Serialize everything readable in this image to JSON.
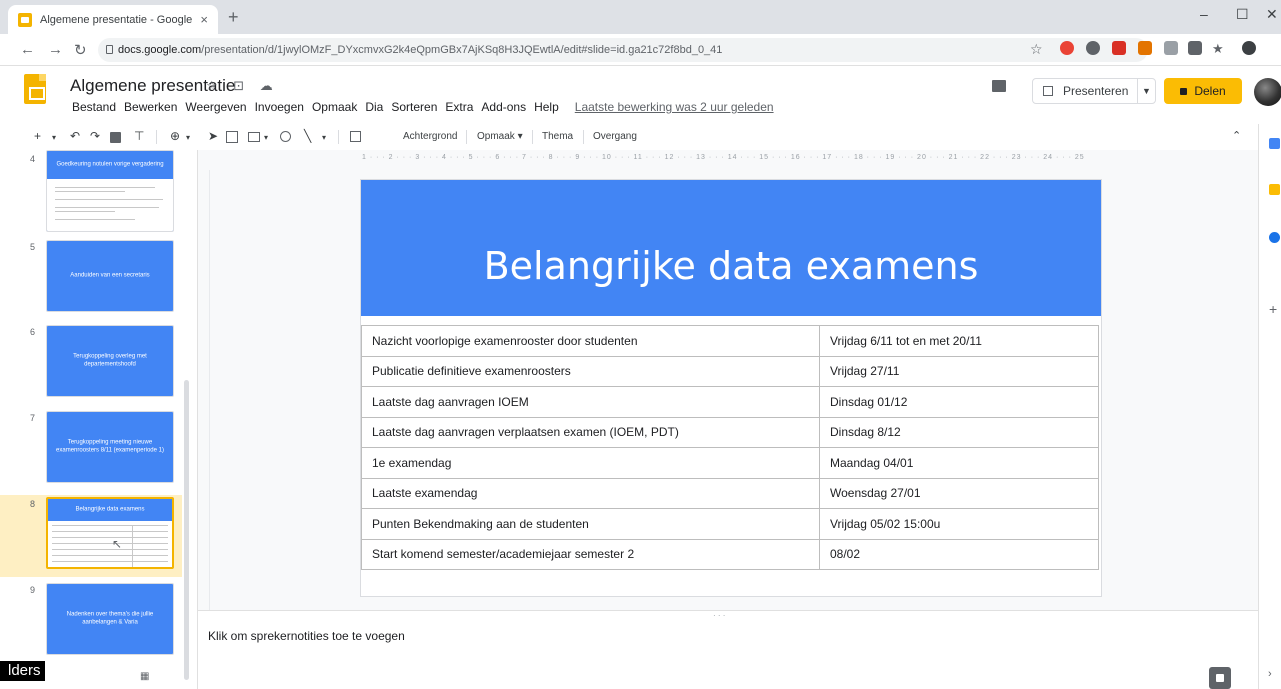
{
  "browser": {
    "tab_title": "Algemene presentatie - Google Sl",
    "tab_close": "×",
    "new_tab": "+",
    "url_host": "docs.google.com",
    "url_path": "/presentation/d/1jwylOMzF_DYxcmvxG2k4eQpmGBx7AjKSq8H3JQEwtlA/edit#slide=id.ga21c72f8bd_0_41",
    "window_minimize": "–",
    "window_maximize": "☐",
    "window_close": "✕"
  },
  "docs": {
    "title": "Algemene presentatie",
    "title_icons": "☆ ⊡ ☁",
    "menu": [
      "Bestand",
      "Bewerken",
      "Weergeven",
      "Invoegen",
      "Opmaak",
      "Dia",
      "Sorteren",
      "Extra",
      "Add-ons",
      "Help"
    ],
    "last_edit": "Laatste bewerking was 2 uur geleden",
    "present_label": "Presenteren",
    "share_label": "Delen"
  },
  "toolbar": {
    "background_label": "Achtergrond",
    "layout_label": "Opmaak ▾",
    "theme_label": "Thema",
    "transition_label": "Overgang"
  },
  "filmstrip": {
    "slides": [
      {
        "number": "4",
        "title": "Goedkeuring notulen vorige vergadering"
      },
      {
        "number": "5",
        "title": "Aanduiden van een secretaris"
      },
      {
        "number": "6",
        "title": "Terugkoppeling overleg met departementshoofd"
      },
      {
        "number": "7",
        "title": "Terugkoppeling meeting nieuwe examenroosters 8/11 (examenperiode 1)"
      },
      {
        "number": "8",
        "title": "Belangrijke data examens"
      },
      {
        "number": "9",
        "title": "Nadenken over thema's die jullie aanbelangen & Varia"
      }
    ],
    "overlay_text": "lders"
  },
  "slide": {
    "title": "Belangrijke data examens",
    "rows": [
      {
        "label": "Nazicht voorlopige examenrooster door studenten",
        "value": "Vrijdag 6/11 tot en met 20/11"
      },
      {
        "label": "Publicatie definitieve examenroosters",
        "value": "Vrijdag 27/11"
      },
      {
        "label": "Laatste dag aanvragen IOEM",
        "value": "Dinsdag 01/12"
      },
      {
        "label": "Laatste dag aanvragen verplaatsen examen (IOEM, PDT)",
        "value": "Dinsdag 8/12"
      },
      {
        "label": "1e examendag",
        "value": "Maandag 04/01"
      },
      {
        "label": "Laatste examendag",
        "value": "Woensdag 27/01"
      },
      {
        "label": "Punten Bekendmaking aan de studenten",
        "value": "Vrijdag 05/02 15:00u"
      },
      {
        "label": "Start komend semester/academiejaar semester 2",
        "value": "08/02"
      }
    ]
  },
  "notes": {
    "placeholder": "Klik om sprekernotities toe te voegen"
  },
  "ruler": "1 · · · 2 · · · 3 · · · 4 · · · 5 · · · 6 · · · 7 · · · 8 · · · 9 · · · 10 · · · 11 · · · 12 · · · 13 · · · 14 · · · 15 · · · 16 · · · 17 · · · 18 · · · 19 · · · 20 · · · 21 · · · 22 · · · 23 · · · 24 · · · 25",
  "colors": {
    "slide_blue": "#4285f4",
    "accent_yellow": "#fbbc04"
  }
}
